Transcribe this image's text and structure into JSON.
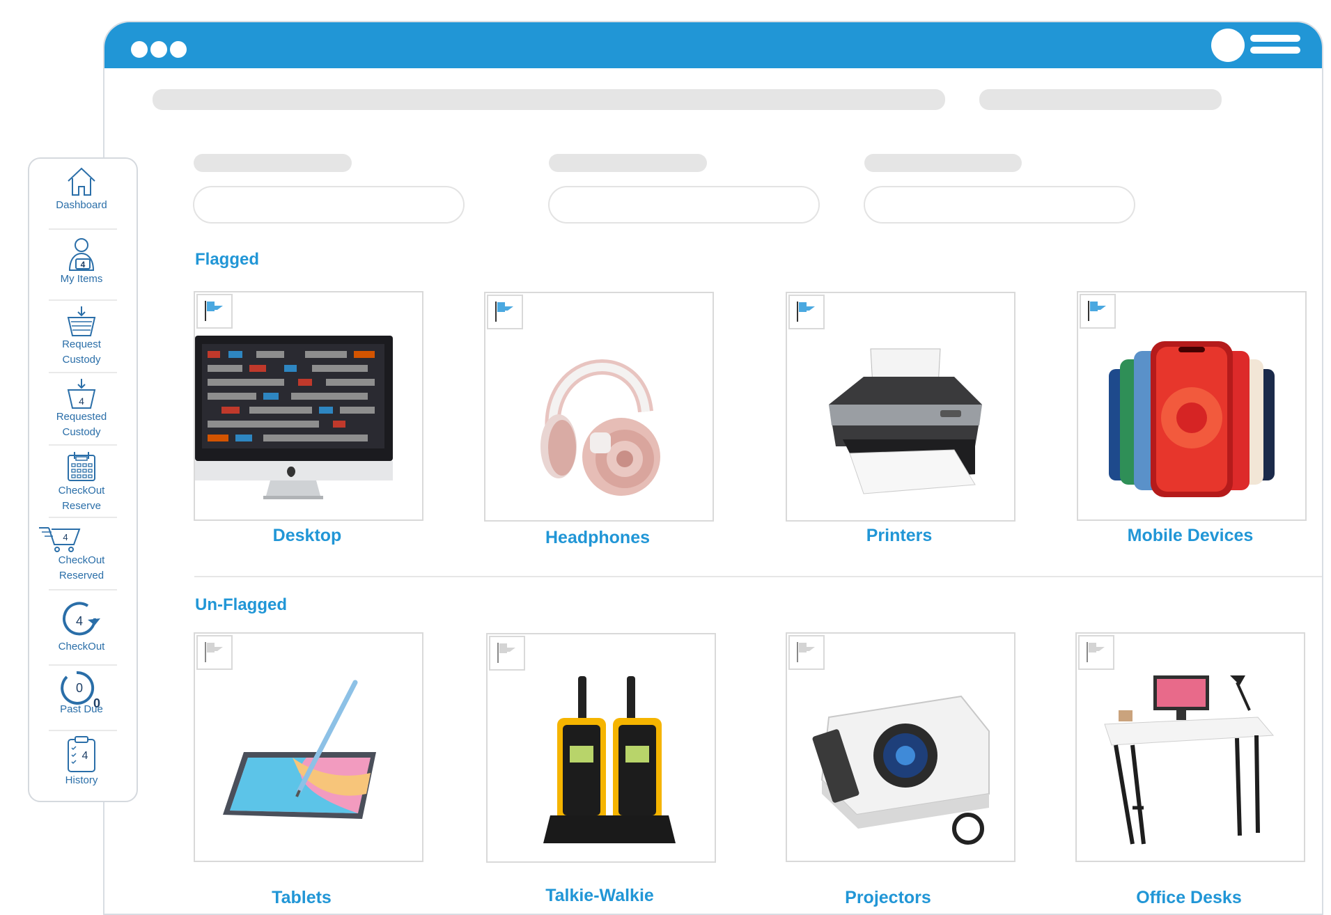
{
  "colors": {
    "accent": "#2196d6",
    "titlebar": "#2196d6",
    "flag_active": "#4aa8e0",
    "flag_inactive": "#d4d4d4",
    "nav_text": "#2a6ea8"
  },
  "sidebar": {
    "items": [
      {
        "label": "Dashboard",
        "icon": "home-icon"
      },
      {
        "label": "My Items",
        "icon": "user-items-icon",
        "badge": "4"
      },
      {
        "label": "Request Custody",
        "icon": "basket-icon"
      },
      {
        "label": "Requested Custody",
        "icon": "basket-icon",
        "badge": "4"
      },
      {
        "label": "CheckOut Reserve",
        "icon": "calendar-icon"
      },
      {
        "label": "CheckOut Reserved",
        "icon": "cart-icon",
        "badge": "4"
      },
      {
        "label": "CheckOut",
        "icon": "refresh-icon",
        "badge": "4"
      },
      {
        "label": "Past Due",
        "icon": "refresh-icon",
        "badge": "0",
        "sub_badge": "0"
      },
      {
        "label": "History",
        "icon": "clipboard-icon",
        "badge": "4"
      }
    ]
  },
  "sections": {
    "flagged": {
      "title": "Flagged",
      "items": [
        {
          "label": "Desktop",
          "image": "desktop-image",
          "flagged": true
        },
        {
          "label": "Headphones",
          "image": "headphones-image",
          "flagged": true
        },
        {
          "label": "Printers",
          "image": "printer-image",
          "flagged": true
        },
        {
          "label": "Mobile Devices",
          "image": "mobile-devices-image",
          "flagged": true
        }
      ]
    },
    "unflagged": {
      "title": "Un-Flagged",
      "items": [
        {
          "label": "Tablets",
          "image": "tablet-image",
          "flagged": false
        },
        {
          "label": "Talkie-Walkie",
          "image": "walkie-talkie-image",
          "flagged": false
        },
        {
          "label": "Projectors",
          "image": "projector-image",
          "flagged": false
        },
        {
          "label": "Office Desks",
          "image": "office-desk-image",
          "flagged": false
        }
      ]
    }
  }
}
